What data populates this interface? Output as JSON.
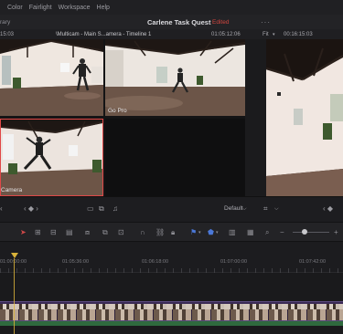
{
  "menubar": {
    "items": [
      "Color",
      "Fairlight",
      "Workspace",
      "Help"
    ]
  },
  "titlebar": {
    "left_fragment": "rary",
    "project_title": "Carlene Task Quest",
    "status": "Edited",
    "more": "···"
  },
  "viewer_header": {
    "timecode_left": "15:03",
    "clip_title": "\\Multicam - Main S...amera - Timeline 1",
    "source_timecode": "01:05:12:06",
    "fit_label": "Fit",
    "record_timecode": "00:16:15:03"
  },
  "multicam": {
    "angles": [
      {
        "label": ""
      },
      {
        "label": "Go Pro"
      },
      {
        "label": "Camera"
      },
      {
        "label": ""
      }
    ]
  },
  "viewer_controls": {
    "default_label": "Default"
  },
  "ruler": {
    "labels": [
      "01:00:00:00",
      "01:05:36:00",
      "01:06:18:00",
      "01:07:00:00",
      "01:07:42:00"
    ]
  },
  "colors": {
    "accent_red": "#e04848",
    "playhead": "#d8b23a",
    "edited_status": "#d2463f",
    "video_clip": "#3a2a55",
    "audio_clip": "#2f6a3e"
  }
}
